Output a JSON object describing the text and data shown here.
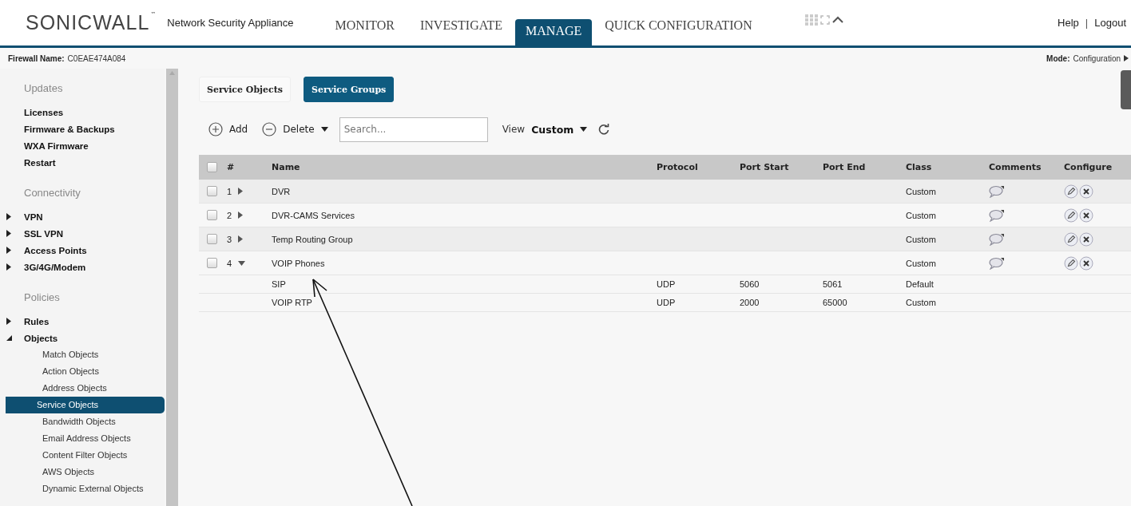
{
  "header": {
    "logo": "SONICWALL",
    "trademark": "™",
    "product": "Network Security Appliance",
    "nav": [
      {
        "label": "MONITOR",
        "selected": false
      },
      {
        "label": "INVESTIGATE",
        "selected": false
      },
      {
        "label": "MANAGE",
        "selected": true
      },
      {
        "label": "QUICK CONFIGURATION",
        "selected": false
      }
    ],
    "links": [
      "Help",
      "Logout"
    ],
    "separator": "|"
  },
  "infobar": {
    "firewall_label": "Firewall Name:",
    "firewall_name": "C0EAE474A084",
    "mode_label": "Mode:",
    "mode": "Configuration"
  },
  "sidebar": {
    "sections": [
      {
        "title": "Updates",
        "items": [
          {
            "label": "Licenses",
            "selected": false
          },
          {
            "label": "Firmware & Backups",
            "selected": false
          },
          {
            "label": "WXA Firmware",
            "selected": false
          },
          {
            "label": "Restart",
            "selected": false
          }
        ]
      },
      {
        "title": "Connectivity",
        "items": [
          {
            "label": "VPN",
            "expanded": false,
            "selected": false
          },
          {
            "label": "SSL VPN",
            "expanded": false,
            "selected": false
          },
          {
            "label": "Access Points",
            "expanded": false,
            "selected": false
          },
          {
            "label": "3G/4G/Modem",
            "expanded": false,
            "selected": false
          }
        ]
      },
      {
        "title": "Policies",
        "items": [
          {
            "label": "Rules",
            "expanded": false,
            "selected": false
          },
          {
            "label": "Objects",
            "expanded": true,
            "selected": false,
            "children": [
              {
                "label": "Match Objects",
                "selected": false
              },
              {
                "label": "Action Objects",
                "selected": false
              },
              {
                "label": "Address Objects",
                "selected": false
              },
              {
                "label": "Service Objects",
                "selected": true
              },
              {
                "label": "Bandwidth Objects",
                "selected": false
              },
              {
                "label": "Email Address Objects",
                "selected": false
              },
              {
                "label": "Content Filter Objects",
                "selected": false
              },
              {
                "label": "AWS Objects",
                "selected": false
              },
              {
                "label": "Dynamic External Objects",
                "selected": false
              }
            ]
          }
        ]
      }
    ]
  },
  "tabs": [
    {
      "label": "Service Objects",
      "selected": false
    },
    {
      "label": "Service Groups",
      "selected": true
    }
  ],
  "toolbar": {
    "add": "Add",
    "delete": "Delete",
    "search": {
      "placeholder": "Search..."
    },
    "view_label": "View",
    "view_value": "Custom"
  },
  "table": {
    "all_checked": false,
    "columns": [
      "#",
      "Name",
      "Protocol",
      "Port Start",
      "Port End",
      "Class",
      "Comments",
      "Configure"
    ],
    "rows": [
      {
        "kind": "group",
        "number": "1",
        "expanded": false,
        "checked": false,
        "name": "DVR",
        "class": "Custom"
      },
      {
        "kind": "group",
        "number": "2",
        "expanded": false,
        "checked": false,
        "name": "DVR-CAMS Services",
        "class": "Custom"
      },
      {
        "kind": "group",
        "number": "3",
        "expanded": false,
        "checked": false,
        "name": "Temp Routing Group",
        "class": "Custom"
      },
      {
        "kind": "group",
        "number": "4",
        "expanded": true,
        "checked": false,
        "name": "VOIP Phones",
        "class": "Custom"
      },
      {
        "kind": "member",
        "name": "SIP",
        "protocol": "UDP",
        "port_start": "5060",
        "port_end": "5061",
        "class": "Default"
      },
      {
        "kind": "member",
        "name": "VOIP RTP",
        "protocol": "UDP",
        "port_start": "2000",
        "port_end": "65000",
        "class": "Custom"
      }
    ]
  }
}
